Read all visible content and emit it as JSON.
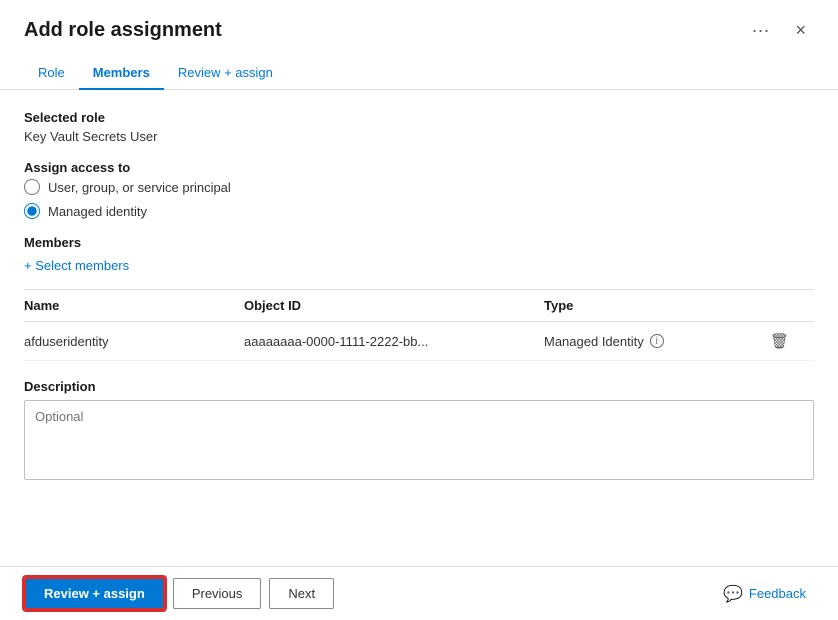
{
  "dialog": {
    "title": "Add role assignment",
    "close_label": "×",
    "ellipsis_label": "···"
  },
  "tabs": [
    {
      "id": "role",
      "label": "Role",
      "active": false
    },
    {
      "id": "members",
      "label": "Members",
      "active": true
    },
    {
      "id": "review",
      "label": "Review + assign",
      "active": false
    }
  ],
  "selected_role": {
    "label": "Selected role",
    "value": "Key Vault Secrets User"
  },
  "assign_access": {
    "label": "Assign access to",
    "options": [
      {
        "id": "user-group",
        "label": "User, group, or service principal",
        "checked": false
      },
      {
        "id": "managed-identity",
        "label": "Managed identity",
        "checked": true
      }
    ]
  },
  "members": {
    "heading": "Members",
    "select_link": "+ Select members",
    "table": {
      "headers": [
        "Name",
        "Object ID",
        "Type"
      ],
      "rows": [
        {
          "name": "afduseridentity",
          "object_id": "aaaaaaaa-0000-1111-2222-bb...",
          "type": "Managed Identity"
        }
      ]
    }
  },
  "description": {
    "label": "Description",
    "placeholder": "Optional"
  },
  "footer": {
    "review_assign_label": "Review + assign",
    "previous_label": "Previous",
    "next_label": "Next",
    "feedback_label": "Feedback"
  }
}
